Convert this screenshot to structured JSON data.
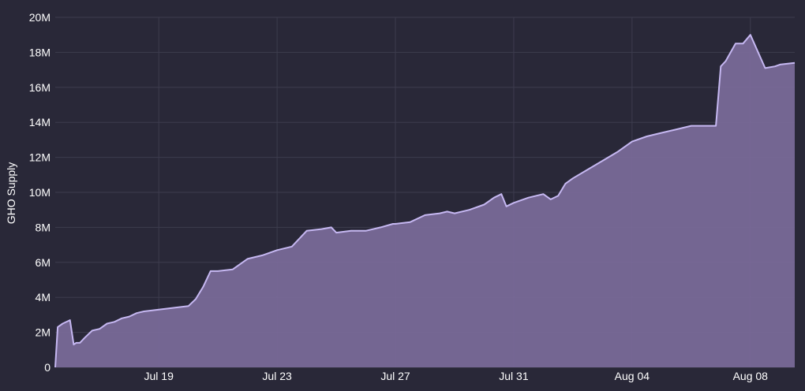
{
  "chart_data": {
    "type": "area",
    "title": "",
    "xlabel": "",
    "ylabel": "GHO Supply",
    "grid": true,
    "legend": "none",
    "colors": {
      "background": "#292838",
      "grid": "#3d3c4e",
      "line": "#c6b8f2",
      "fill": "#7b6b9a",
      "text": "#ffffff"
    },
    "xlim": [
      "2023-07-15T12:00",
      "2023-08-09T12:00"
    ],
    "ylim": [
      0,
      20000000
    ],
    "x_ticks": [
      {
        "date": "2023-07-19",
        "label": "Jul 19"
      },
      {
        "date": "2023-07-23",
        "label": "Jul 23"
      },
      {
        "date": "2023-07-27",
        "label": "Jul 27"
      },
      {
        "date": "2023-07-31",
        "label": "Jul 31"
      },
      {
        "date": "2023-08-04",
        "label": "Aug 04"
      },
      {
        "date": "2023-08-08",
        "label": "Aug 08"
      }
    ],
    "y_ticks": [
      {
        "value": 0,
        "label": "0"
      },
      {
        "value": 2000000,
        "label": "2M"
      },
      {
        "value": 4000000,
        "label": "4M"
      },
      {
        "value": 6000000,
        "label": "6M"
      },
      {
        "value": 8000000,
        "label": "8M"
      },
      {
        "value": 10000000,
        "label": "10M"
      },
      {
        "value": 12000000,
        "label": "12M"
      },
      {
        "value": 14000000,
        "label": "14M"
      },
      {
        "value": 16000000,
        "label": "16M"
      },
      {
        "value": 18000000,
        "label": "18M"
      },
      {
        "value": 20000000,
        "label": "20M"
      }
    ],
    "series": [
      {
        "x": [
          "2023-07-15T12:00",
          "2023-07-15T14:00",
          "2023-07-15T18:00",
          "2023-07-16T00:00",
          "2023-07-16T03:00",
          "2023-07-16T05:00",
          "2023-07-16T08:00",
          "2023-07-16T12:00",
          "2023-07-16T18:00",
          "2023-07-17T00:00",
          "2023-07-17T06:00",
          "2023-07-17T12:00",
          "2023-07-17T18:00",
          "2023-07-18T00:00",
          "2023-07-18T06:00",
          "2023-07-18T12:00",
          "2023-07-19T00:00",
          "2023-07-19T12:00",
          "2023-07-20T00:00",
          "2023-07-20T06:00",
          "2023-07-20T12:00",
          "2023-07-20T18:00",
          "2023-07-21T00:00",
          "2023-07-21T12:00",
          "2023-07-22T00:00",
          "2023-07-22T12:00",
          "2023-07-23T00:00",
          "2023-07-23T12:00",
          "2023-07-24T00:00",
          "2023-07-24T12:00",
          "2023-07-24T20:00",
          "2023-07-25T00:00",
          "2023-07-25T12:00",
          "2023-07-26T00:00",
          "2023-07-26T12:00",
          "2023-07-26T22:00",
          "2023-07-27T00:00",
          "2023-07-27T12:00",
          "2023-07-28T00:00",
          "2023-07-28T12:00",
          "2023-07-28T18:00",
          "2023-07-29T00:00",
          "2023-07-29T12:00",
          "2023-07-30T00:00",
          "2023-07-30T08:00",
          "2023-07-30T14:00",
          "2023-07-30T18:00",
          "2023-07-31T00:00",
          "2023-07-31T12:00",
          "2023-08-01T00:00",
          "2023-08-01T06:00",
          "2023-08-01T12:00",
          "2023-08-01T18:00",
          "2023-08-02T00:00",
          "2023-08-02T12:00",
          "2023-08-03T00:00",
          "2023-08-03T12:00",
          "2023-08-04T00:00",
          "2023-08-04T12:00",
          "2023-08-05T00:00",
          "2023-08-05T12:00",
          "2023-08-06T00:00",
          "2023-08-06T12:00",
          "2023-08-06T20:00",
          "2023-08-07T00:00",
          "2023-08-07T04:00",
          "2023-08-07T12:00",
          "2023-08-07T18:00",
          "2023-08-08T00:00",
          "2023-08-08T12:00",
          "2023-08-08T20:00",
          "2023-08-09T00:00",
          "2023-08-09T12:00"
        ],
        "values": [
          0,
          2300000,
          2500000,
          2700000,
          1300000,
          1400000,
          1400000,
          1700000,
          2100000,
          2200000,
          2500000,
          2600000,
          2800000,
          2900000,
          3100000,
          3200000,
          3300000,
          3400000,
          3500000,
          3900000,
          4600000,
          5500000,
          5500000,
          5600000,
          6200000,
          6400000,
          6700000,
          6900000,
          7800000,
          7900000,
          8000000,
          7700000,
          7800000,
          7800000,
          8000000,
          8200000,
          8200000,
          8300000,
          8700000,
          8800000,
          8900000,
          8800000,
          9000000,
          9300000,
          9700000,
          9900000,
          9200000,
          9400000,
          9700000,
          9900000,
          9600000,
          9800000,
          10500000,
          10800000,
          11300000,
          11800000,
          12300000,
          12900000,
          13200000,
          13400000,
          13600000,
          13800000,
          13800000,
          13800000,
          17200000,
          17500000,
          18500000,
          18500000,
          19000000,
          17100000,
          17200000,
          17300000,
          17400000
        ]
      }
    ]
  }
}
